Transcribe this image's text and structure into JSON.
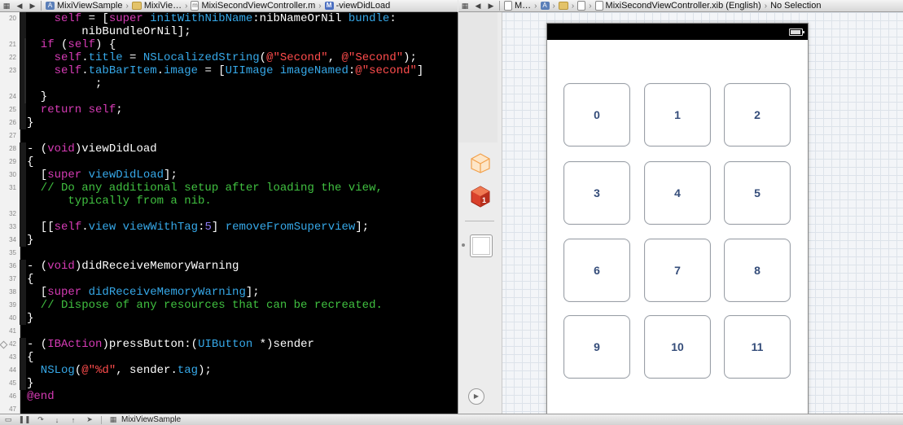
{
  "left_jumpbar": {
    "crumbs": [
      "MixiViewSample",
      "MixiVie…",
      "MixiSecondViewController.m",
      "-viewDidLoad"
    ]
  },
  "right_jumpbar": {
    "crumbs": [
      "M…",
      "MixiSecondViewController.xib (English)",
      "No Selection"
    ]
  },
  "code": {
    "lines": [
      {
        "n": "20",
        "t": "self = [super initWithNibName:nibNameOrNil bundle:"
      },
      {
        "n": "",
        "t": "nibBundleOrNil];"
      },
      {
        "n": "21",
        "t": "if (self) {"
      },
      {
        "n": "22",
        "t": "self.title = NSLocalizedString(@\"Second\", @\"Second\");"
      },
      {
        "n": "23",
        "t": "self.tabBarItem.image = [UIImage imageNamed:@\"second\"]"
      },
      {
        "n": "",
        "t": ";"
      },
      {
        "n": "24",
        "t": "}"
      },
      {
        "n": "25",
        "t": "return self;"
      },
      {
        "n": "26",
        "t": "}"
      },
      {
        "n": "27",
        "t": ""
      },
      {
        "n": "28",
        "t": "- (void)viewDidLoad"
      },
      {
        "n": "29",
        "t": "{"
      },
      {
        "n": "30",
        "t": "[super viewDidLoad];"
      },
      {
        "n": "31",
        "t": "// Do any additional setup after loading the view,"
      },
      {
        "n": "",
        "t": "typically from a nib."
      },
      {
        "n": "32",
        "t": ""
      },
      {
        "n": "33",
        "t": "[[self.view viewWithTag:5] removeFromSuperview];"
      },
      {
        "n": "34",
        "t": "}"
      },
      {
        "n": "35",
        "t": ""
      },
      {
        "n": "36",
        "t": "- (void)didReceiveMemoryWarning"
      },
      {
        "n": "37",
        "t": "{"
      },
      {
        "n": "38",
        "t": "[super didReceiveMemoryWarning];"
      },
      {
        "n": "39",
        "t": "// Dispose of any resources that can be recreated."
      },
      {
        "n": "40",
        "t": "}"
      },
      {
        "n": "41",
        "t": ""
      },
      {
        "n": "42",
        "t": "- (IBAction)pressButton:(UIButton *)sender"
      },
      {
        "n": "43",
        "t": "{"
      },
      {
        "n": "44",
        "t": "NSLog(@\"%d\", sender.tag);"
      },
      {
        "n": "45",
        "t": "}"
      },
      {
        "n": "46",
        "t": "@end"
      },
      {
        "n": "47",
        "t": ""
      }
    ]
  },
  "buttons": [
    "0",
    "1",
    "2",
    "3",
    "4",
    "5",
    "6",
    "7",
    "8",
    "9",
    "10",
    "11"
  ],
  "debugbar": {
    "scheme": "MixiViewSample"
  },
  "colors": {
    "editor_bg": "#000000",
    "keyword": "#d63bb5",
    "class": "#36a8e8",
    "string": "#ff4c4c",
    "comment": "#40c040",
    "number": "#8f7df5",
    "button_text": "#354d7a"
  }
}
